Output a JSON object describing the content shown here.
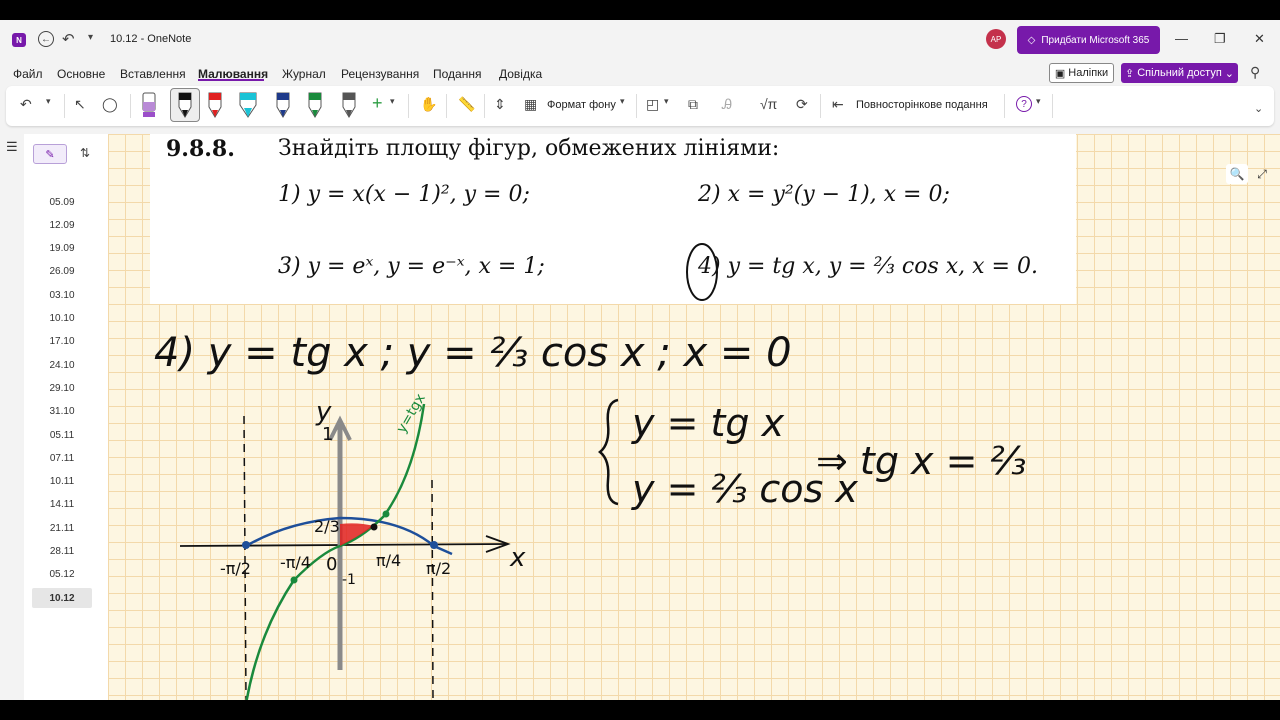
{
  "window": {
    "title": "10.12  -  OneNote",
    "avatar_initials": "AP",
    "m365_label": "Придбати Microsoft 365"
  },
  "menu": {
    "tabs": [
      "Файл",
      "Основне",
      "Вставлення",
      "Малювання",
      "Журнал",
      "Рецензування",
      "Подання",
      "Довідка"
    ],
    "active": "Малювання",
    "notes_label": "Наліпки",
    "share_label": "Спільний доступ"
  },
  "ribbon": {
    "background_format_label": "Формат фону",
    "full_page_label": "Повносторінкове подання",
    "pen_colors": [
      "#9b4fc9",
      "#111111",
      "#e02020",
      "#19c3d6",
      "#1e3a8a",
      "#1a8a3c",
      "#555555"
    ],
    "add_color": "#2e9e44"
  },
  "pages": [
    "05.09",
    "12.09",
    "19.09",
    "26.09",
    "03.10",
    "10.10",
    "17.10",
    "24.10",
    "29.10",
    "31.10",
    "05.11",
    "07.11",
    "10.11",
    "14.11",
    "21.11",
    "28.11",
    "05.12",
    "10.12"
  ],
  "selected_page": "10.12",
  "task": {
    "number": "9.8.8.",
    "heading": "Знайдіть площу фігур, обмежених лініями:",
    "items": [
      {
        "n": "1)",
        "expr": "y = x(x − 1)², y = 0;"
      },
      {
        "n": "2)",
        "expr": "x = y²(y − 1), x = 0;"
      },
      {
        "n": "3)",
        "expr": "y = eˣ, y = e⁻ˣ, x = 1;"
      },
      {
        "n": "4)",
        "expr": "y = tg x, y = ⅔ cos x, x = 0."
      }
    ]
  },
  "handwriting": {
    "line1": "4)  y = tg x ;  y = ⅔ cos x ;   x = 0",
    "system_line1": "y = tg x",
    "system_line2": "y = ⅔ cos x",
    "result": "⇒ tg x = ⅔",
    "graph_labels": {
      "y_axis": "y",
      "x_axis": "x",
      "tg_label": "y=tgx",
      "two_thirds": "2/3",
      "one": "1",
      "minus_one": "-1",
      "zero": "0",
      "neg_pi_half": "-π/2",
      "neg_pi_quarter": "-π/4",
      "pi_quarter": "π/4",
      "pi_half": "π/2"
    }
  },
  "colors": {
    "brand": "#7719aa",
    "ink_black": "#111111",
    "ink_green": "#1a8a3c",
    "ink_blue": "#1e4f9a",
    "ink_red": "#e02020",
    "axis_gray": "#8a8a8a",
    "canvas_bg": "#fdf6e1",
    "grid": "#f3d9aa"
  }
}
